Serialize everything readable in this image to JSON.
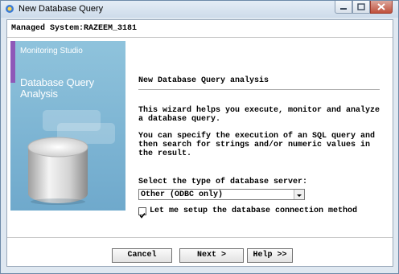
{
  "window": {
    "title": "New Database Query",
    "app_icon": "app-icon",
    "controls": [
      "minimize-icon",
      "maximize-icon",
      "close-icon"
    ]
  },
  "header": {
    "managed_system": "Managed System:RAZEEM_3181"
  },
  "banner": {
    "brand": "Monitoring Studio",
    "title_line1": "Database Query",
    "title_line2": "Analysis",
    "accent_color": "#8e58b8",
    "background_color": "#7fb7d6"
  },
  "wizard": {
    "section_title": "New Database Query analysis",
    "intro_lines": [
      "This wizard helps you execute, monitor and analyze",
      "a database query."
    ],
    "detail_lines": [
      "You can specify the execution of an SQL query and",
      "then search for strings and/or numeric values in",
      "the result."
    ],
    "server_label": "Select the type of database server:",
    "server_selected": "Other (ODBC only)",
    "setup_checkbox_checked": true,
    "setup_checkbox_label": "Let me setup the database connection method"
  },
  "buttons": {
    "cancel": "Cancel",
    "next": "Next >",
    "help": "Help >>"
  }
}
